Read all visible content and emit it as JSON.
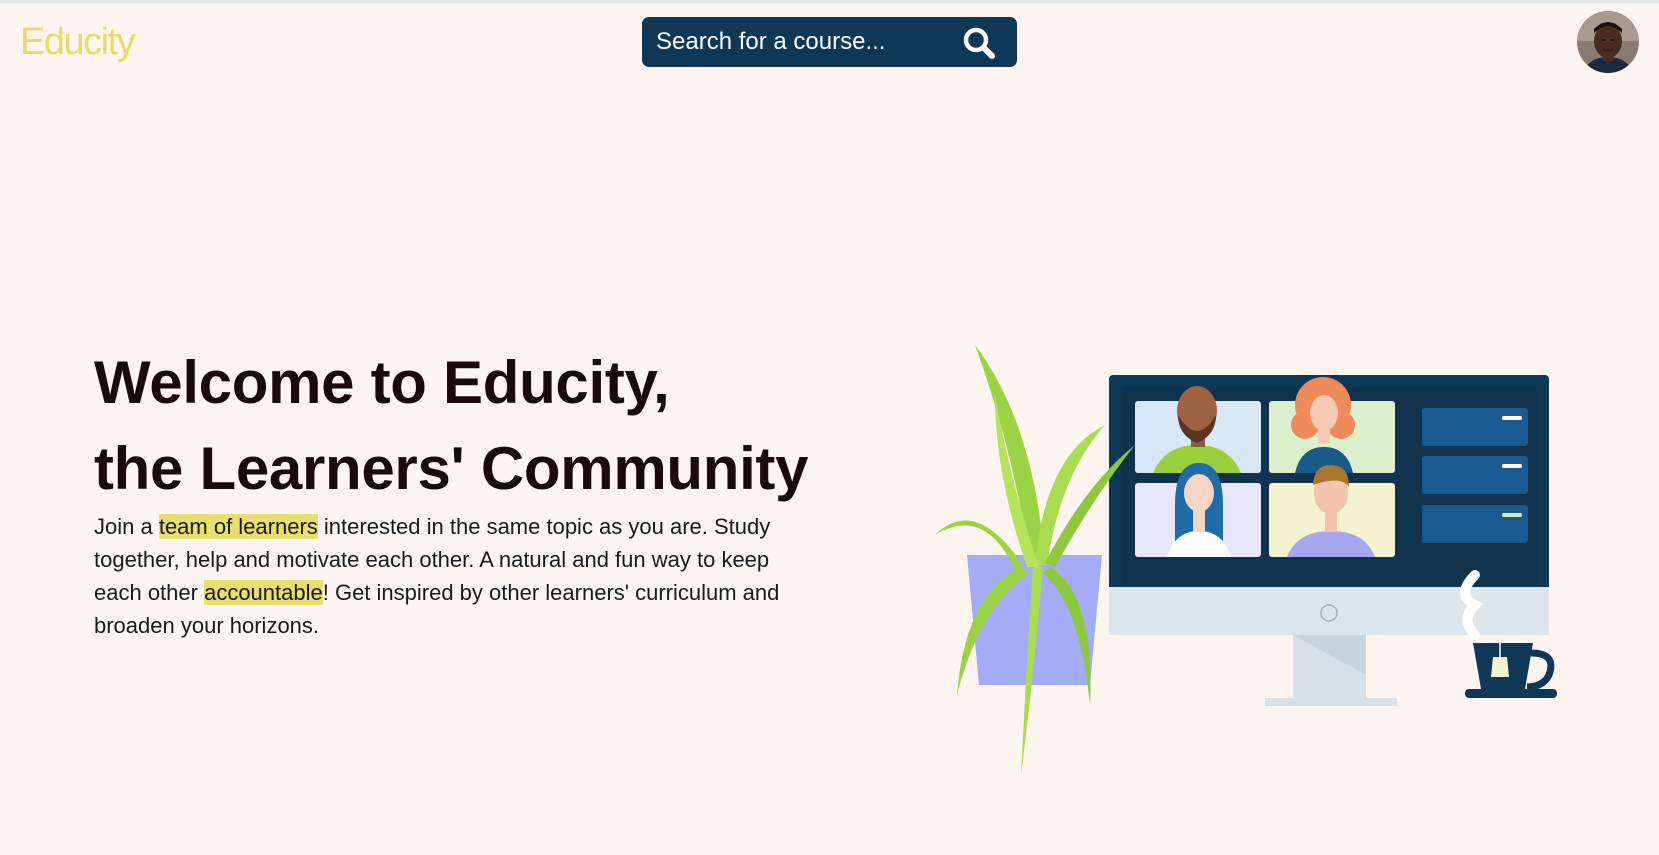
{
  "header": {
    "logo": "Educity",
    "search_placeholder": "Search for a course...",
    "avatar_alt": "User profile"
  },
  "hero": {
    "title_line1": "Welcome to Educity,",
    "title_line2": "the Learners' Community",
    "text_part1": "Join a ",
    "highlight1": "team of learners",
    "text_part2": " interested in the same topic as you are. Study together, help and motivate each other. A natural and fun way to keep each other ",
    "highlight2": "accountable",
    "text_part3": "! Get inspired by other learners' curriculum and broaden your horizons."
  },
  "colors": {
    "background": "#fef5f0",
    "brand": "#e6dc6a",
    "highlight": "#e8df70",
    "search_bg": "#0f3856",
    "heading": "#1a0a08"
  },
  "icons": {
    "search": "search-icon",
    "avatar": "avatar"
  }
}
